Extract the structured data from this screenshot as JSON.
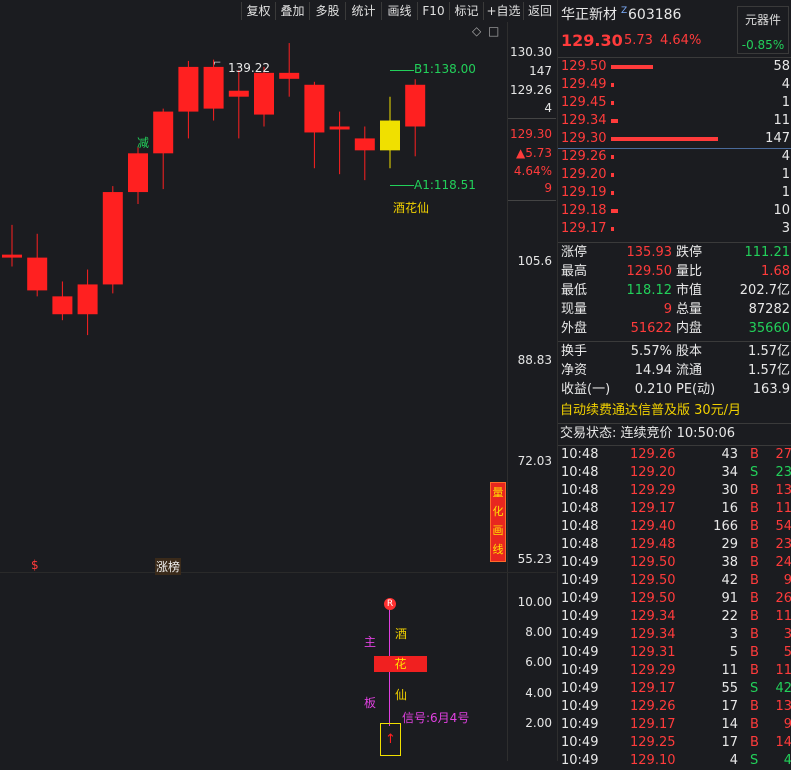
{
  "toolbar": {
    "buttons": [
      "复权",
      "叠加",
      "多股",
      "统计",
      "画线",
      "F10",
      "标记",
      "+自选",
      "返回"
    ],
    "diamond_icon": "◇",
    "square_icon": "□"
  },
  "chart": {
    "price_axis": [
      "130.30",
      "147",
      "129.26",
      "4",
      "105.6",
      "88.83",
      "72.03",
      "55.23"
    ],
    "side_info": {
      "price": "129.30",
      "change": "▲5.73",
      "pct": "4.64%",
      "vol": "9"
    },
    "high_marker": "139.22",
    "b1_label": "B1:138.00",
    "a1_label": "A1:118.51",
    "jian_label": "减",
    "jiuhuaxian_label": "酒花仙",
    "quant_box": [
      "量",
      "化",
      "画",
      "线"
    ],
    "s_marker": "$",
    "zhangbang": "涨榜",
    "indicator_axis": [
      "10.00",
      "8.00",
      "6.00",
      "4.00",
      "2.00"
    ],
    "ind_zhu": "主",
    "ind_ban": "板",
    "ind_jiu": "酒",
    "ind_hua": "花",
    "ind_xian": "仙",
    "signal": "信号:6月4号",
    "r_badge": "R",
    "up_arrow": "↑",
    "candles": [
      {
        "o": 106.5,
        "c": 106.0,
        "h": 111.5,
        "l": 104.5
      },
      {
        "o": 106.0,
        "c": 100.5,
        "h": 110.0,
        "l": 99.5
      },
      {
        "o": 99.5,
        "c": 96.5,
        "h": 102.0,
        "l": 95.5
      },
      {
        "o": 96.5,
        "c": 101.5,
        "h": 104.0,
        "l": 93.0
      },
      {
        "o": 101.5,
        "c": 117.0,
        "h": 118.0,
        "l": 100.0
      },
      {
        "o": 117.0,
        "c": 123.5,
        "h": 124.5,
        "l": 115.0
      },
      {
        "o": 123.5,
        "c": 130.5,
        "h": 131.0,
        "l": 117.5
      },
      {
        "o": 130.5,
        "c": 138.0,
        "h": 139.0,
        "l": 126.0
      },
      {
        "o": 138.0,
        "c": 131.0,
        "h": 139.22,
        "l": 129.0
      },
      {
        "o": 134.0,
        "c": 133.0,
        "h": 137.5,
        "l": 126.0
      },
      {
        "o": 137.0,
        "c": 130.0,
        "h": 138.0,
        "l": 128.0
      },
      {
        "o": 137.0,
        "c": 136.0,
        "h": 142.0,
        "l": 133.0
      },
      {
        "o": 135.0,
        "c": 127.0,
        "h": 135.5,
        "l": 121.0
      },
      {
        "o": 128.0,
        "c": 127.5,
        "h": 130.5,
        "l": 120.0
      },
      {
        "o": 126.0,
        "c": 124.0,
        "h": 128.0,
        "l": 119.0
      },
      {
        "o": 124.0,
        "c": 129.0,
        "h": 133.0,
        "l": 121.0
      },
      {
        "o": 135.0,
        "c": 128.0,
        "h": 135.93,
        "l": 123.0
      }
    ]
  },
  "stock": {
    "name": "华正新材",
    "code": "603186",
    "mark": "Z",
    "price": "129.30",
    "change": "5.73",
    "pct": "4.64%",
    "sector": "元器件",
    "sector_pct": "-0.85%"
  },
  "asks": [
    {
      "p": "129.50",
      "v": "58",
      "bar": 42
    },
    {
      "p": "129.49",
      "v": "4",
      "bar": 3
    },
    {
      "p": "129.45",
      "v": "1",
      "bar": 3
    },
    {
      "p": "129.34",
      "v": "11",
      "bar": 7
    },
    {
      "p": "129.30",
      "v": "147",
      "bar": 107
    }
  ],
  "bids": [
    {
      "p": "129.26",
      "v": "4",
      "bar": 3
    },
    {
      "p": "129.20",
      "v": "1",
      "bar": 3
    },
    {
      "p": "129.19",
      "v": "1",
      "bar": 3
    },
    {
      "p": "129.18",
      "v": "10",
      "bar": 7
    },
    {
      "p": "129.17",
      "v": "3",
      "bar": 3
    }
  ],
  "stats1": [
    {
      "l1": "涨停",
      "v1": "135.93",
      "c1": "red",
      "l2": "跌停",
      "v2": "111.21",
      "c2": "green"
    },
    {
      "l1": "最高",
      "v1": "129.50",
      "c1": "red",
      "l2": "量比",
      "v2": "1.68",
      "c2": "red"
    },
    {
      "l1": "最低",
      "v1": "118.12",
      "c1": "green",
      "l2": "市值",
      "v2": "202.7亿",
      "c2": "white"
    },
    {
      "l1": "现量",
      "v1": "9",
      "c1": "red",
      "l2": "总量",
      "v2": "87282",
      "c2": "white"
    },
    {
      "l1": "外盘",
      "v1": "51622",
      "c1": "red",
      "l2": "内盘",
      "v2": "35660",
      "c2": "green"
    }
  ],
  "stats2": [
    {
      "l1": "换手",
      "v1": "5.57%",
      "l2": "股本",
      "v2": "1.57亿"
    },
    {
      "l1": "净资",
      "v1": "14.94",
      "l2": "流通",
      "v2": "1.57亿"
    },
    {
      "l1": "收益(一)",
      "v1": "0.210",
      "l2": "PE(动)",
      "v2": "163.9"
    }
  ],
  "promo": "自动续费通达信普及版  30元/月",
  "trade_status": "交易状态: 连续竞价 10:50:06",
  "ticks": [
    {
      "t": "10:48",
      "p": "129.26",
      "v": "43",
      "d": "B",
      "n": "27"
    },
    {
      "t": "10:48",
      "p": "129.20",
      "v": "34",
      "d": "S",
      "n": "23"
    },
    {
      "t": "10:48",
      "p": "129.29",
      "v": "30",
      "d": "B",
      "n": "13"
    },
    {
      "t": "10:48",
      "p": "129.17",
      "v": "16",
      "d": "B",
      "n": "11"
    },
    {
      "t": "10:48",
      "p": "129.40",
      "v": "166",
      "d": "B",
      "n": "54"
    },
    {
      "t": "10:48",
      "p": "129.48",
      "v": "29",
      "d": "B",
      "n": "23"
    },
    {
      "t": "10:49",
      "p": "129.50",
      "v": "38",
      "d": "B",
      "n": "24"
    },
    {
      "t": "10:49",
      "p": "129.50",
      "v": "42",
      "d": "B",
      "n": "9"
    },
    {
      "t": "10:49",
      "p": "129.50",
      "v": "91",
      "d": "B",
      "n": "26"
    },
    {
      "t": "10:49",
      "p": "129.34",
      "v": "22",
      "d": "B",
      "n": "11"
    },
    {
      "t": "10:49",
      "p": "129.34",
      "v": "3",
      "d": "B",
      "n": "3"
    },
    {
      "t": "10:49",
      "p": "129.31",
      "v": "5",
      "d": "B",
      "n": "5"
    },
    {
      "t": "10:49",
      "p": "129.29",
      "v": "11",
      "d": "B",
      "n": "11"
    },
    {
      "t": "10:49",
      "p": "129.17",
      "v": "55",
      "d": "S",
      "n": "42"
    },
    {
      "t": "10:49",
      "p": "129.26",
      "v": "17",
      "d": "B",
      "n": "13"
    },
    {
      "t": "10:49",
      "p": "129.17",
      "v": "14",
      "d": "B",
      "n": "9"
    },
    {
      "t": "10:49",
      "p": "129.25",
      "v": "17",
      "d": "B",
      "n": "14"
    },
    {
      "t": "10:49",
      "p": "129.10",
      "v": "4",
      "d": "S",
      "n": "4"
    }
  ],
  "colors": {
    "up": "#ff2020",
    "down": "#22d05a",
    "bg": "#1b1c20",
    "yellow": "#f0e000"
  }
}
